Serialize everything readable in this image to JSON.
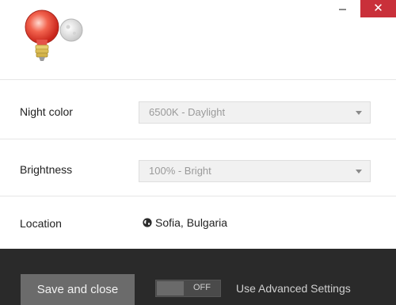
{
  "window": {
    "minimize_label": "",
    "close_label": "✕"
  },
  "settings": {
    "night_color": {
      "label": "Night color",
      "value": "6500K - Daylight"
    },
    "brightness": {
      "label": "Brightness",
      "value": "100% - Bright"
    },
    "location": {
      "label": "Location",
      "value": "Sofia, Bulgaria",
      "icon": "globe-icon"
    }
  },
  "footer": {
    "save_label": "Save and close",
    "toggle_state": "OFF",
    "advanced_label": "Use Advanced Settings"
  },
  "colors": {
    "close_button": "#c9303a",
    "footer_bg": "#2a2a2a",
    "save_button_bg": "#6b6b6b",
    "select_bg": "#f1f1f1"
  }
}
